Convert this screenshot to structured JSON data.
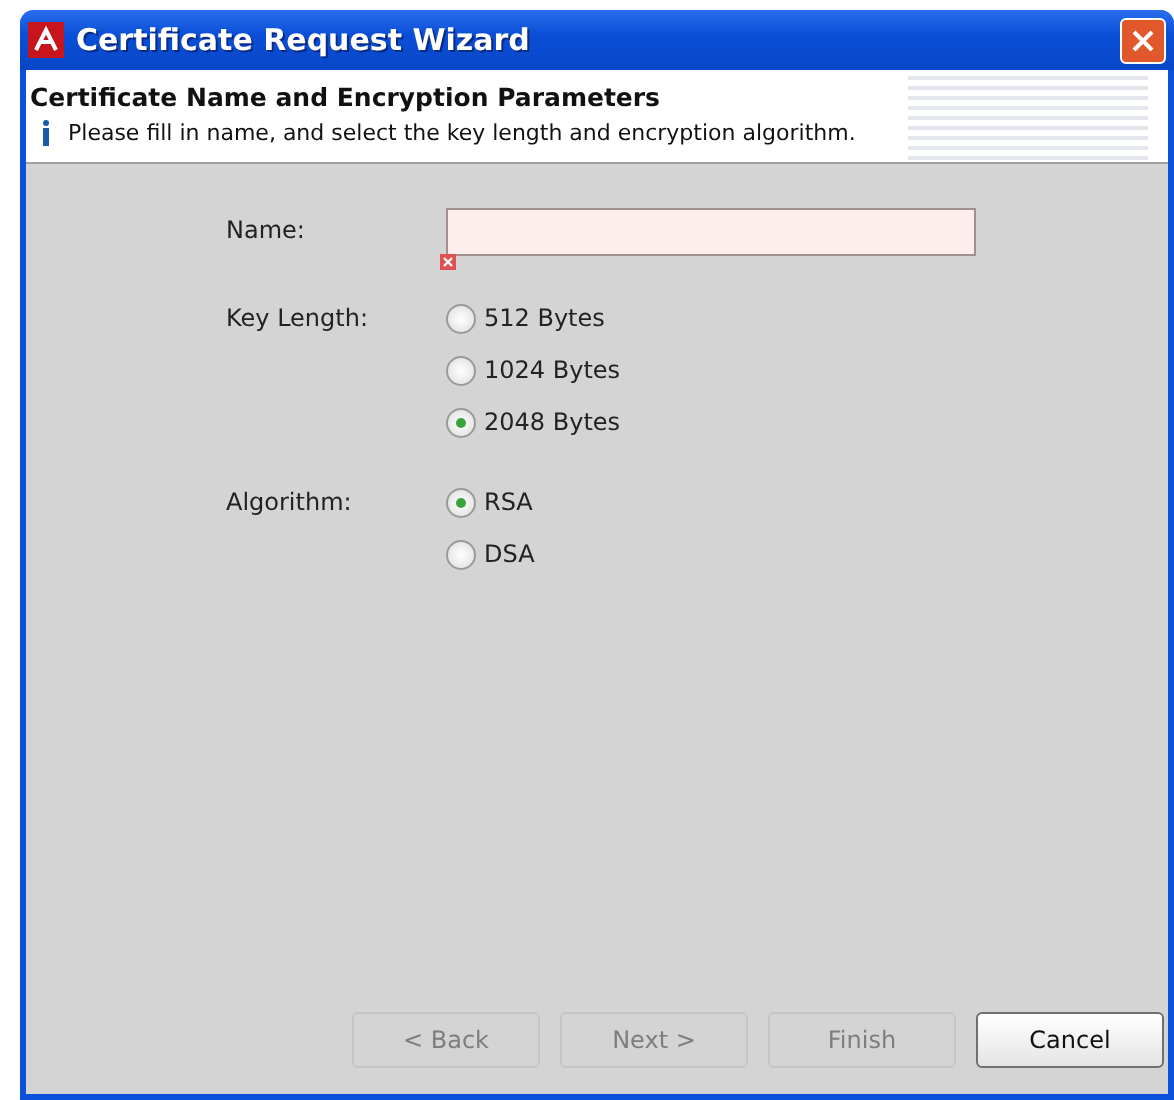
{
  "window": {
    "title": "Certificate Request Wizard"
  },
  "header": {
    "title": "Certificate Name and Encryption Parameters",
    "hint": "Please fill in name, and select the key length and encryption algorithm."
  },
  "name_field": {
    "label": "Name:",
    "invalid": true
  },
  "key_length": {
    "label": "Key Length:",
    "options": [
      {
        "label": "512 Bytes",
        "selected": false
      },
      {
        "label": "1024 Bytes",
        "selected": false
      },
      {
        "label": "2048 Bytes",
        "selected": true
      }
    ]
  },
  "algorithm": {
    "label": "Algorithm:",
    "options": [
      {
        "label": "RSA",
        "selected": true
      },
      {
        "label": "DSA",
        "selected": false
      }
    ]
  },
  "buttons": [
    {
      "label": "< Back",
      "disabled": true
    },
    {
      "label": "Next >",
      "disabled": true
    },
    {
      "label": "Finish",
      "disabled": true
    },
    {
      "label": "Cancel",
      "disabled": false
    }
  ]
}
